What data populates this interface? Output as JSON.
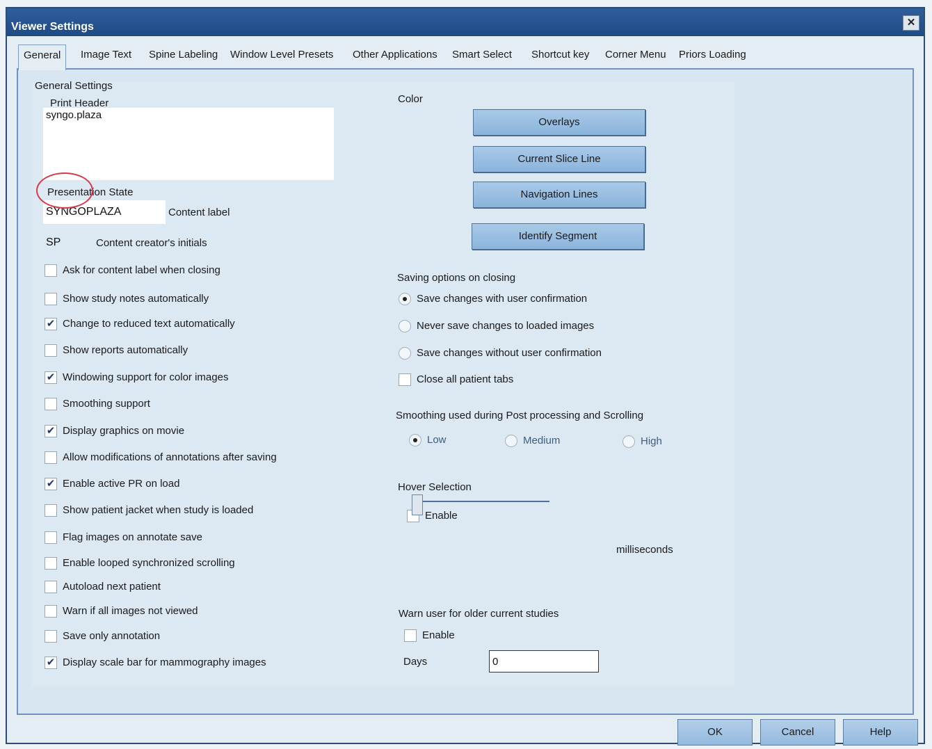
{
  "window": {
    "title": "Viewer Settings",
    "close_glyph": "✕"
  },
  "tabs": [
    "General",
    "Image Text",
    "Spine Labeling",
    "Window Level Presets",
    "Other Applications",
    "Smart Select",
    "Shortcut key",
    "Corner Menu",
    "Priors Loading"
  ],
  "general": {
    "section_title": "General Settings",
    "print_header_label": "Print Header",
    "print_header_value": "syngo.plaza",
    "presentation_state_label": "Presentation State",
    "presentation_state_value": "SYNGOPLAZA",
    "content_label": "Content label",
    "initials_value": "SP",
    "initials_label": "Content creator's initials",
    "checkboxes": [
      {
        "label": "Ask for content label when closing",
        "checked": false
      },
      {
        "label": "Show study notes automatically",
        "checked": false
      },
      {
        "label": "Change to reduced text automatically",
        "checked": true
      },
      {
        "label": "Show reports automatically",
        "checked": false
      },
      {
        "label": "Windowing support for color images",
        "checked": true
      },
      {
        "label": "Smoothing support",
        "checked": false
      },
      {
        "label": "Display graphics on movie",
        "checked": true
      },
      {
        "label": "Allow modifications of annotations after saving",
        "checked": false
      },
      {
        "label": "Enable active PR on load",
        "checked": true
      },
      {
        "label": "Show patient jacket when study is loaded",
        "checked": false
      },
      {
        "label": "Flag images on annotate save",
        "checked": false
      },
      {
        "label": "Enable looped synchronized scrolling",
        "checked": false
      },
      {
        "label": "Autoload next patient",
        "checked": false
      },
      {
        "label": "Warn if all images not viewed",
        "checked": false
      },
      {
        "label": "Save only annotation",
        "checked": false
      },
      {
        "label": "Display scale bar for mammography images",
        "checked": true
      }
    ]
  },
  "color": {
    "title": "Color",
    "buttons": [
      "Overlays",
      "Current Slice Line",
      "Navigation Lines",
      "Identify Segment"
    ]
  },
  "saving": {
    "title": "Saving options on closing",
    "options": [
      {
        "label": "Save changes with user confirmation",
        "selected": true
      },
      {
        "label": "Never save changes to loaded images",
        "selected": false
      },
      {
        "label": "Save changes without user confirmation",
        "selected": false
      }
    ],
    "close_tabs_label": "Close all patient tabs",
    "close_tabs_checked": false
  },
  "smoothing": {
    "title": "Smoothing used during Post processing and Scrolling",
    "options": [
      {
        "label": "Low",
        "selected": true
      },
      {
        "label": "Medium",
        "selected": false
      },
      {
        "label": "High",
        "selected": false
      }
    ]
  },
  "hover": {
    "title": "Hover Selection",
    "enable_label": "Enable",
    "enabled": false,
    "unit_label": "milliseconds",
    "slider_level": 0
  },
  "warn_older": {
    "title": "Warn user for older current studies",
    "enable_label": "Enable",
    "enabled": false,
    "days_label": "Days",
    "days_value": "0"
  },
  "footer": {
    "ok": "OK",
    "cancel": "Cancel",
    "help": "Help"
  },
  "check_glyph": "✔"
}
